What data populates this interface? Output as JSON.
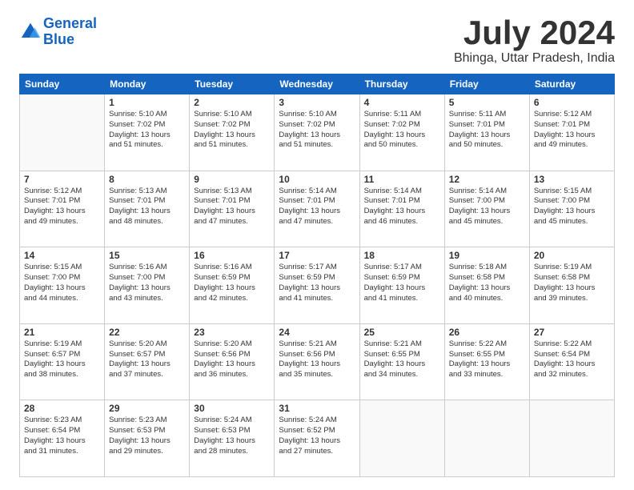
{
  "logo": {
    "line1": "General",
    "line2": "Blue"
  },
  "title": "July 2024",
  "subtitle": "Bhinga, Uttar Pradesh, India",
  "days_of_week": [
    "Sunday",
    "Monday",
    "Tuesday",
    "Wednesday",
    "Thursday",
    "Friday",
    "Saturday"
  ],
  "weeks": [
    [
      {
        "day": "",
        "empty": true
      },
      {
        "day": "1",
        "sunrise": "5:10 AM",
        "sunset": "7:02 PM",
        "daylight": "13 hours and 51 minutes."
      },
      {
        "day": "2",
        "sunrise": "5:10 AM",
        "sunset": "7:02 PM",
        "daylight": "13 hours and 51 minutes."
      },
      {
        "day": "3",
        "sunrise": "5:10 AM",
        "sunset": "7:02 PM",
        "daylight": "13 hours and 51 minutes."
      },
      {
        "day": "4",
        "sunrise": "5:11 AM",
        "sunset": "7:02 PM",
        "daylight": "13 hours and 50 minutes."
      },
      {
        "day": "5",
        "sunrise": "5:11 AM",
        "sunset": "7:01 PM",
        "daylight": "13 hours and 50 minutes."
      },
      {
        "day": "6",
        "sunrise": "5:12 AM",
        "sunset": "7:01 PM",
        "daylight": "13 hours and 49 minutes."
      }
    ],
    [
      {
        "day": "7",
        "sunrise": "5:12 AM",
        "sunset": "7:01 PM",
        "daylight": "13 hours and 49 minutes."
      },
      {
        "day": "8",
        "sunrise": "5:13 AM",
        "sunset": "7:01 PM",
        "daylight": "13 hours and 48 minutes."
      },
      {
        "day": "9",
        "sunrise": "5:13 AM",
        "sunset": "7:01 PM",
        "daylight": "13 hours and 47 minutes."
      },
      {
        "day": "10",
        "sunrise": "5:14 AM",
        "sunset": "7:01 PM",
        "daylight": "13 hours and 47 minutes."
      },
      {
        "day": "11",
        "sunrise": "5:14 AM",
        "sunset": "7:01 PM",
        "daylight": "13 hours and 46 minutes."
      },
      {
        "day": "12",
        "sunrise": "5:14 AM",
        "sunset": "7:00 PM",
        "daylight": "13 hours and 45 minutes."
      },
      {
        "day": "13",
        "sunrise": "5:15 AM",
        "sunset": "7:00 PM",
        "daylight": "13 hours and 45 minutes."
      }
    ],
    [
      {
        "day": "14",
        "sunrise": "5:15 AM",
        "sunset": "7:00 PM",
        "daylight": "13 hours and 44 minutes."
      },
      {
        "day": "15",
        "sunrise": "5:16 AM",
        "sunset": "7:00 PM",
        "daylight": "13 hours and 43 minutes."
      },
      {
        "day": "16",
        "sunrise": "5:16 AM",
        "sunset": "6:59 PM",
        "daylight": "13 hours and 42 minutes."
      },
      {
        "day": "17",
        "sunrise": "5:17 AM",
        "sunset": "6:59 PM",
        "daylight": "13 hours and 41 minutes."
      },
      {
        "day": "18",
        "sunrise": "5:17 AM",
        "sunset": "6:59 PM",
        "daylight": "13 hours and 41 minutes."
      },
      {
        "day": "19",
        "sunrise": "5:18 AM",
        "sunset": "6:58 PM",
        "daylight": "13 hours and 40 minutes."
      },
      {
        "day": "20",
        "sunrise": "5:19 AM",
        "sunset": "6:58 PM",
        "daylight": "13 hours and 39 minutes."
      }
    ],
    [
      {
        "day": "21",
        "sunrise": "5:19 AM",
        "sunset": "6:57 PM",
        "daylight": "13 hours and 38 minutes."
      },
      {
        "day": "22",
        "sunrise": "5:20 AM",
        "sunset": "6:57 PM",
        "daylight": "13 hours and 37 minutes."
      },
      {
        "day": "23",
        "sunrise": "5:20 AM",
        "sunset": "6:56 PM",
        "daylight": "13 hours and 36 minutes."
      },
      {
        "day": "24",
        "sunrise": "5:21 AM",
        "sunset": "6:56 PM",
        "daylight": "13 hours and 35 minutes."
      },
      {
        "day": "25",
        "sunrise": "5:21 AM",
        "sunset": "6:55 PM",
        "daylight": "13 hours and 34 minutes."
      },
      {
        "day": "26",
        "sunrise": "5:22 AM",
        "sunset": "6:55 PM",
        "daylight": "13 hours and 33 minutes."
      },
      {
        "day": "27",
        "sunrise": "5:22 AM",
        "sunset": "6:54 PM",
        "daylight": "13 hours and 32 minutes."
      }
    ],
    [
      {
        "day": "28",
        "sunrise": "5:23 AM",
        "sunset": "6:54 PM",
        "daylight": "13 hours and 31 minutes."
      },
      {
        "day": "29",
        "sunrise": "5:23 AM",
        "sunset": "6:53 PM",
        "daylight": "13 hours and 29 minutes."
      },
      {
        "day": "30",
        "sunrise": "5:24 AM",
        "sunset": "6:53 PM",
        "daylight": "13 hours and 28 minutes."
      },
      {
        "day": "31",
        "sunrise": "5:24 AM",
        "sunset": "6:52 PM",
        "daylight": "13 hours and 27 minutes."
      },
      {
        "day": "",
        "empty": true
      },
      {
        "day": "",
        "empty": true
      },
      {
        "day": "",
        "empty": true
      }
    ]
  ]
}
